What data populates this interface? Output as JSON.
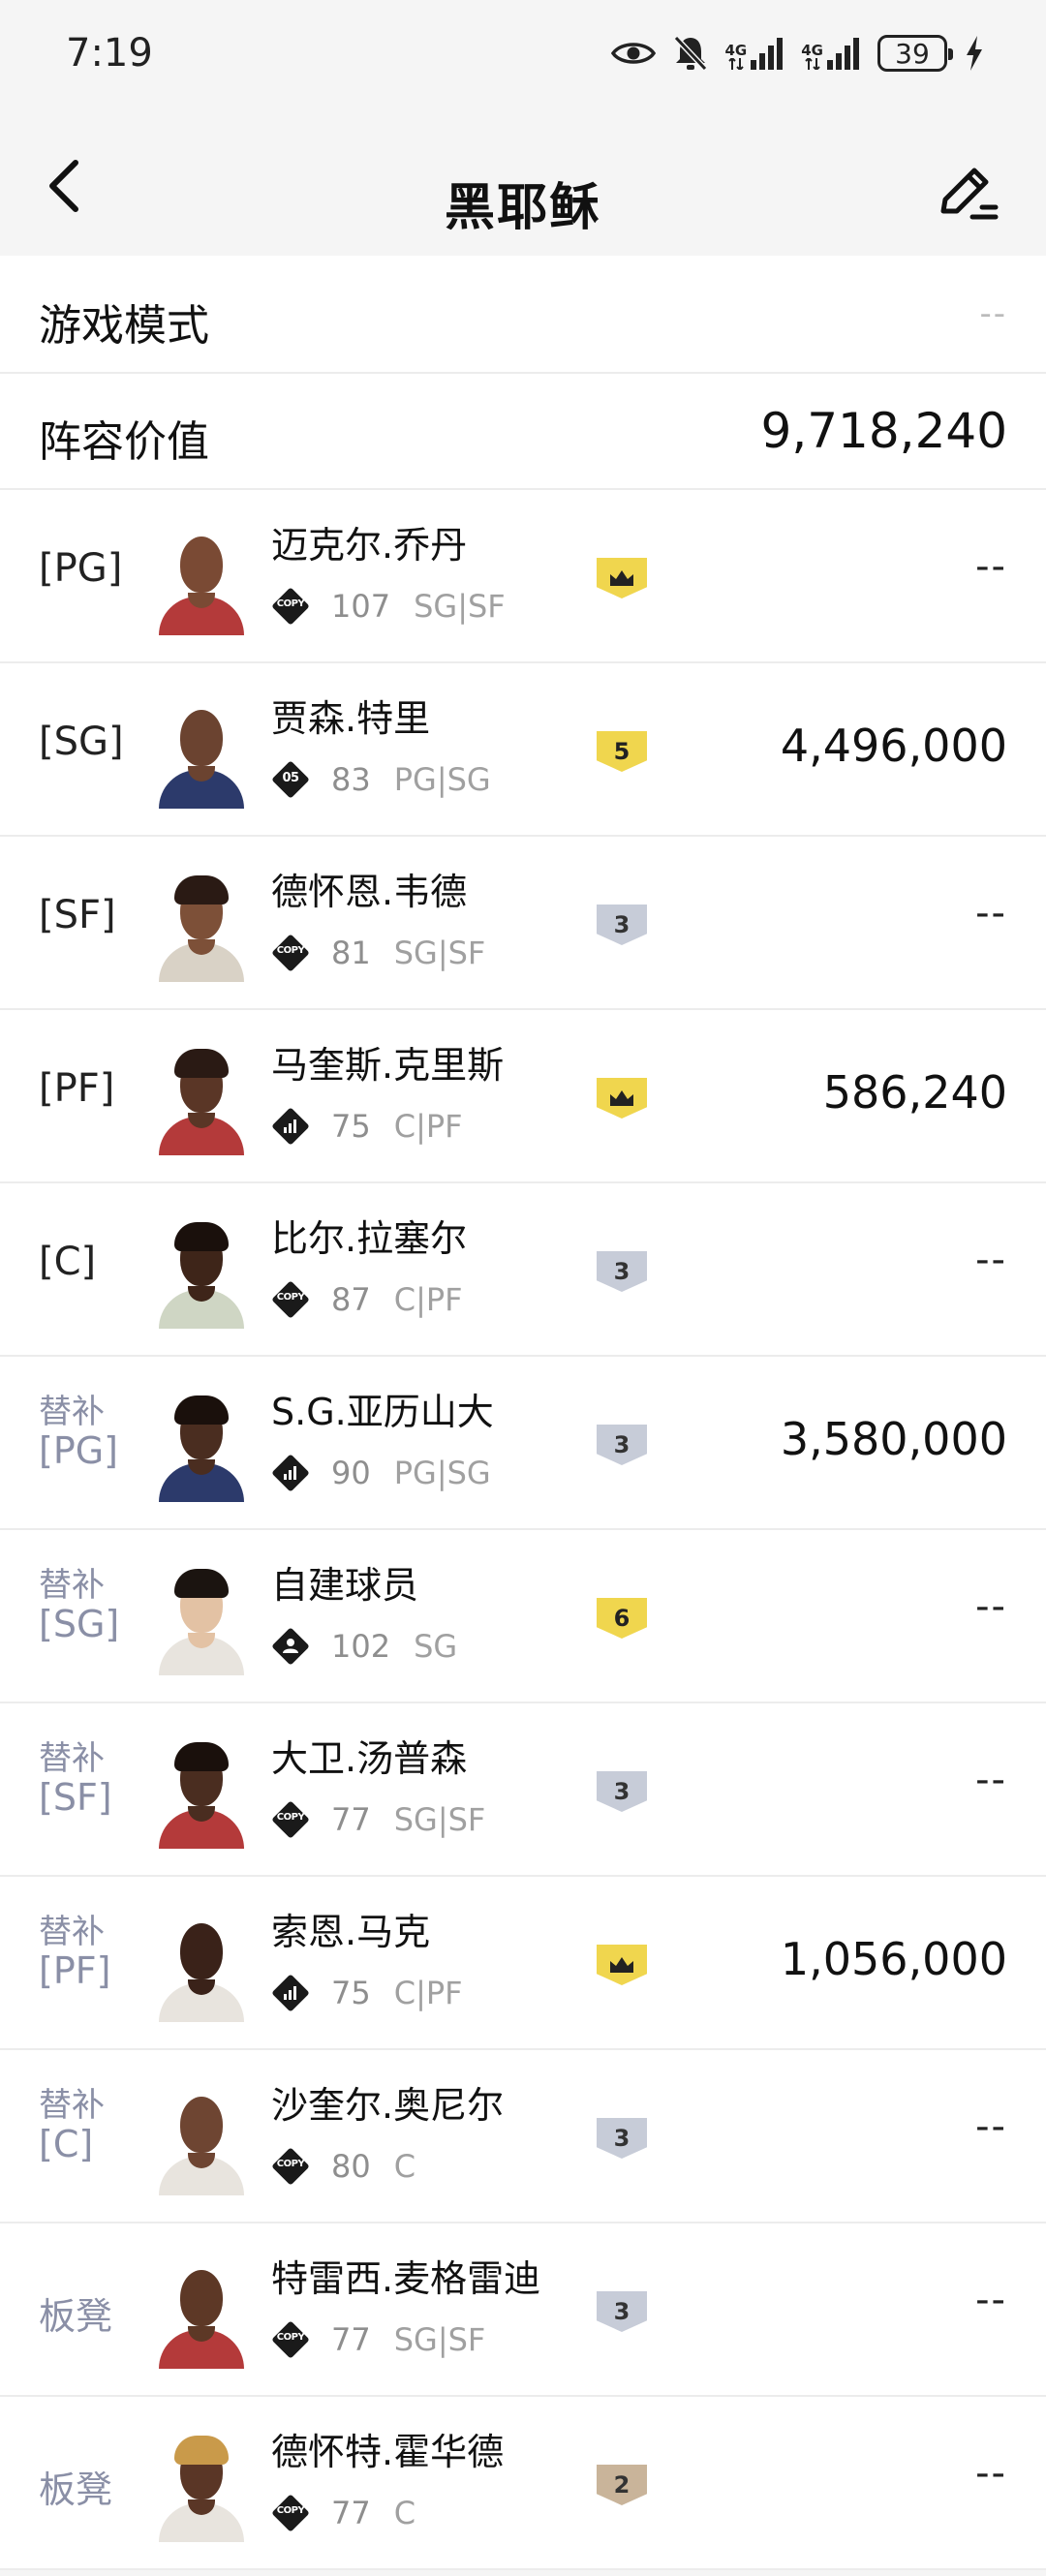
{
  "status_bar": {
    "time": "7:19",
    "network1": "4G",
    "network2": "4G",
    "battery": "39",
    "icons": [
      "eye-icon",
      "bell-off-icon",
      "signal-icon",
      "signal-icon",
      "battery-icon",
      "charging-icon"
    ]
  },
  "header": {
    "title": "黑耶稣",
    "back_icon": "chevron-left-icon",
    "edit_icon": "edit-icon"
  },
  "game_mode": {
    "label": "游戏模式",
    "value": "--"
  },
  "lineup_value": {
    "label": "阵容价值",
    "value": "9,718,240"
  },
  "players": [
    {
      "slot": "[PG]",
      "slot_type": "starter",
      "name": "迈克尔.乔丹",
      "card": "COPY",
      "ovr": "107",
      "positions": "SG|SF",
      "badge": "crown",
      "badge_color": "gold",
      "value": "--"
    },
    {
      "slot": "[SG]",
      "slot_type": "starter",
      "name": "贾森.特里",
      "card": "05",
      "ovr": "83",
      "positions": "PG|SG",
      "badge": "5",
      "badge_color": "gold",
      "value": "4,496,000"
    },
    {
      "slot": "[SF]",
      "slot_type": "starter",
      "name": "德怀恩.韦德",
      "card": "COPY",
      "ovr": "81",
      "positions": "SG|SF",
      "badge": "3",
      "badge_color": "silver",
      "value": "--"
    },
    {
      "slot": "[PF]",
      "slot_type": "starter",
      "name": "马奎斯.克里斯",
      "card": "bars",
      "ovr": "75",
      "positions": "C|PF",
      "badge": "crown",
      "badge_color": "gold",
      "value": "586,240"
    },
    {
      "slot": "[C]",
      "slot_type": "starter",
      "name": "比尔.拉塞尔",
      "card": "COPY",
      "ovr": "87",
      "positions": "C|PF",
      "badge": "3",
      "badge_color": "silver",
      "value": "--"
    },
    {
      "slot": "[PG]",
      "slot_type": "sub",
      "sub_label": "替补",
      "name": "S.G.亚历山大",
      "card": "bars",
      "ovr": "90",
      "positions": "PG|SG",
      "badge": "3",
      "badge_color": "silver",
      "value": "3,580,000"
    },
    {
      "slot": "[SG]",
      "slot_type": "sub",
      "sub_label": "替补",
      "name": "自建球员",
      "card": "person",
      "ovr": "102",
      "positions": "SG",
      "badge": "6",
      "badge_color": "gold",
      "value": "--"
    },
    {
      "slot": "[SF]",
      "slot_type": "sub",
      "sub_label": "替补",
      "name": "大卫.汤普森",
      "card": "COPY",
      "ovr": "77",
      "positions": "SG|SF",
      "badge": "3",
      "badge_color": "silver",
      "value": "--"
    },
    {
      "slot": "[PF]",
      "slot_type": "sub",
      "sub_label": "替补",
      "name": "索恩.马克",
      "card": "bars",
      "ovr": "75",
      "positions": "C|PF",
      "badge": "crown",
      "badge_color": "gold",
      "value": "1,056,000"
    },
    {
      "slot": "[C]",
      "slot_type": "sub",
      "sub_label": "替补",
      "name": "沙奎尔.奥尼尔",
      "card": "COPY",
      "ovr": "80",
      "positions": "C",
      "badge": "3",
      "badge_color": "silver",
      "value": "--"
    },
    {
      "slot": "板凳",
      "slot_type": "bench",
      "name": "特雷西.麦格雷迪",
      "card": "COPY",
      "ovr": "77",
      "positions": "SG|SF",
      "badge": "3",
      "badge_color": "silver",
      "value": "--"
    },
    {
      "slot": "板凳",
      "slot_type": "bench",
      "name": "德怀特.霍华德",
      "card": "COPY",
      "ovr": "77",
      "positions": "C",
      "badge": "2",
      "badge_color": "bronze",
      "value": "--"
    }
  ],
  "avatars": [
    {
      "skin": "#7a4a34",
      "shirt": "#b43a3a",
      "hair": ""
    },
    {
      "skin": "#6b4330",
      "shirt": "#2c3a6b",
      "hair": ""
    },
    {
      "skin": "#7d5038",
      "shirt": "#d9d2c6",
      "hair": "#2a1a14"
    },
    {
      "skin": "#5a3626",
      "shirt": "#b43a3a",
      "hair": "#2a1a14"
    },
    {
      "skin": "#3e2519",
      "shirt": "#cfd6c4",
      "hair": "#1a100c"
    },
    {
      "skin": "#4a2d20",
      "shirt": "#2c3a6b",
      "hair": "#1a100c"
    },
    {
      "skin": "#e3c2a4",
      "shirt": "#e8e4de",
      "hair": "#1b1410"
    },
    {
      "skin": "#4a2d20",
      "shirt": "#b43a3a",
      "hair": "#1a100c"
    },
    {
      "skin": "#3a2219",
      "shirt": "#e8e4de",
      "hair": ""
    },
    {
      "skin": "#6e4532",
      "shirt": "#e8e4de",
      "hair": ""
    },
    {
      "skin": "#5d3826",
      "shirt": "#b43a3a",
      "hair": ""
    },
    {
      "skin": "#5a3626",
      "shirt": "#e8e4de",
      "hair": "#c99a4a"
    }
  ]
}
